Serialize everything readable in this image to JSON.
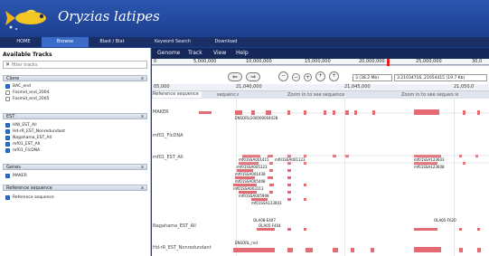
{
  "site": {
    "title": "Oryzias latipes",
    "logo_icon": "medaka-fish-icon"
  },
  "topnav": {
    "items": [
      "HOME",
      "Browse",
      "Blast / Blat",
      "Keyword Search",
      "Download"
    ],
    "active": "Browse"
  },
  "left_panel": {
    "heading": "Available Tracks",
    "filter_placeholder": "filter tracks",
    "categories": [
      {
        "name": "Clone",
        "toggle": "x",
        "tracks": [
          {
            "label": "BAC_end",
            "checked": true
          },
          {
            "label": "Fosmid_end_2004",
            "checked": false
          },
          {
            "label": "Fosmid_end_2005",
            "checked": false
          }
        ]
      },
      {
        "name": "EST",
        "toggle": "x",
        "tracks": [
          {
            "label": "HNI_EST_All",
            "checked": true
          },
          {
            "label": "Hd-rR_EST_Nonredundant",
            "checked": true
          },
          {
            "label": "Nagahama_EST_All",
            "checked": true
          },
          {
            "label": "mf01_EST_All",
            "checked": true
          },
          {
            "label": "mf01_FlcDNA",
            "checked": true
          }
        ]
      },
      {
        "name": "Genes",
        "toggle": "x",
        "tracks": [
          {
            "label": "MAKER",
            "checked": true
          }
        ]
      },
      {
        "name": "Reference sequence",
        "toggle": "x",
        "tracks": [
          {
            "label": "Reference sequence",
            "checked": true
          }
        ]
      }
    ]
  },
  "browser": {
    "menu": [
      "Genome",
      "Track",
      "View",
      "Help"
    ],
    "overview_labels": [
      "0",
      "5,000,000",
      "10,000,000",
      "15,000,000",
      "20,000,000",
      "25,000,000",
      "30,0"
    ],
    "nav": {
      "back_icon": "left-arrow-icon",
      "forward_icon": "right-arrow-icon",
      "zoom_out_icons": [
        "zoom-out-large-icon",
        "zoom-out-small-icon"
      ],
      "zoom_in_icons": [
        "zoom-in-small-icon",
        "zoom-in-large-icon"
      ],
      "region_select": "3 (38.2 Mb)",
      "location": "3:21034716..21054415 (19.7 Kb)"
    },
    "ruler_labels": [
      "05,000",
      "21,040,000",
      "21,045,000",
      "21,050,0"
    ],
    "scale_labels": [
      "05,000",
      "21,040,000",
      "21,045,000",
      "21,050,0"
    ],
    "zoom_banner": {
      "left": "sequence",
      "middle": "Zoom in to see sequence",
      "right": "Zoom in to see sequence",
      "far_left": "Reference sequence"
    },
    "tracks": [
      {
        "name": "MAKER",
        "features": [
          "ENSORLG00000004428"
        ]
      },
      {
        "name": "mf01_FlcDNA",
        "features": []
      },
      {
        "name": "mf01_EST_All",
        "features": [
          "mf01SSA001415",
          "mf01SSA001123",
          "mf01SSA005123",
          "mf01SSA001438",
          "mf01SSA005408",
          "mf01SSA003113",
          "mf01SSA005908",
          "mf01SSA123603",
          "mf01SSA123603",
          "mf01SSA123608"
        ]
      },
      {
        "name": "Nagahama_EST_All",
        "features": [
          "OLA08-E407",
          "OLA05-F404",
          "OLA05-F620"
        ]
      },
      {
        "name": "Hd-rR_EST_Nonredundant",
        "features": [
          "ENSORL_rnd"
        ]
      }
    ],
    "accent_color": "#e46b73"
  }
}
